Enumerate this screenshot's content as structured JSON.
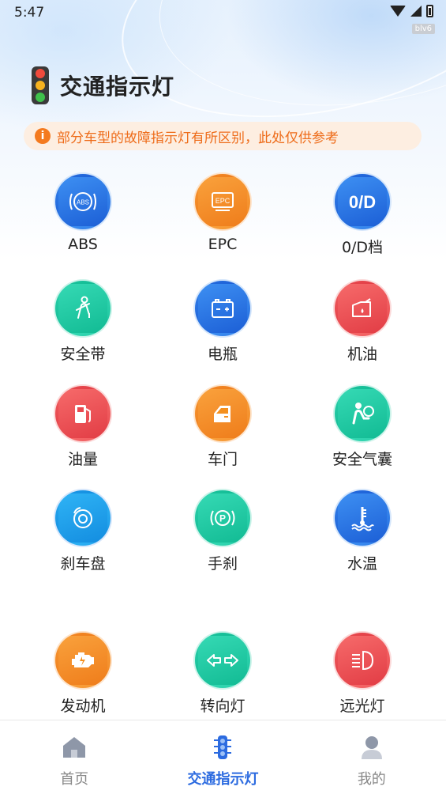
{
  "status_bar": {
    "time": "5:47",
    "badge": "blv6"
  },
  "header": {
    "title": "交通指示灯",
    "icon": "traffic-light-icon"
  },
  "notice": {
    "icon": "info-icon",
    "text": "部分车型的故障指示灯有所区别，此处仅供参考"
  },
  "lights": [
    {
      "label": "ABS",
      "icon": "abs-icon",
      "color": "#2a74e6"
    },
    {
      "label": "EPC",
      "icon": "epc-icon",
      "color": "#f4901f"
    },
    {
      "label": "0/D档",
      "icon": "od-icon",
      "color": "#2a74e6"
    },
    {
      "label": "安全带",
      "icon": "seatbelt-icon",
      "color": "#1ec9a2"
    },
    {
      "label": "电瓶",
      "icon": "battery-icon",
      "color": "#2a74e6"
    },
    {
      "label": "机油",
      "icon": "oil-icon",
      "color": "#e84a50"
    },
    {
      "label": "油量",
      "icon": "fuel-icon",
      "color": "#e84a50"
    },
    {
      "label": "车门",
      "icon": "door-icon",
      "color": "#f4901f"
    },
    {
      "label": "安全气囊",
      "icon": "airbag-icon",
      "color": "#1ec9a2"
    },
    {
      "label": "刹车盘",
      "icon": "brake-disc-icon",
      "color": "#1f9eec"
    },
    {
      "label": "手刹",
      "icon": "handbrake-icon",
      "color": "#1ec9a2"
    },
    {
      "label": "水温",
      "icon": "water-temp-icon",
      "color": "#2a74e6"
    },
    {
      "label": "发动机",
      "icon": "engine-icon",
      "color": "#f4901f"
    },
    {
      "label": "转向灯",
      "icon": "turn-signal-icon",
      "color": "#1ec9a2"
    },
    {
      "label": "远光灯",
      "icon": "high-beam-icon",
      "color": "#e84a50"
    }
  ],
  "bottom_nav": {
    "items": [
      {
        "label": "首页",
        "icon": "home-icon",
        "active": false
      },
      {
        "label": "交通指示灯",
        "icon": "traffic-light-icon",
        "active": true
      },
      {
        "label": "我的",
        "icon": "user-icon",
        "active": false
      }
    ],
    "active_color": "#2c6be0",
    "inactive_color": "#888888"
  }
}
